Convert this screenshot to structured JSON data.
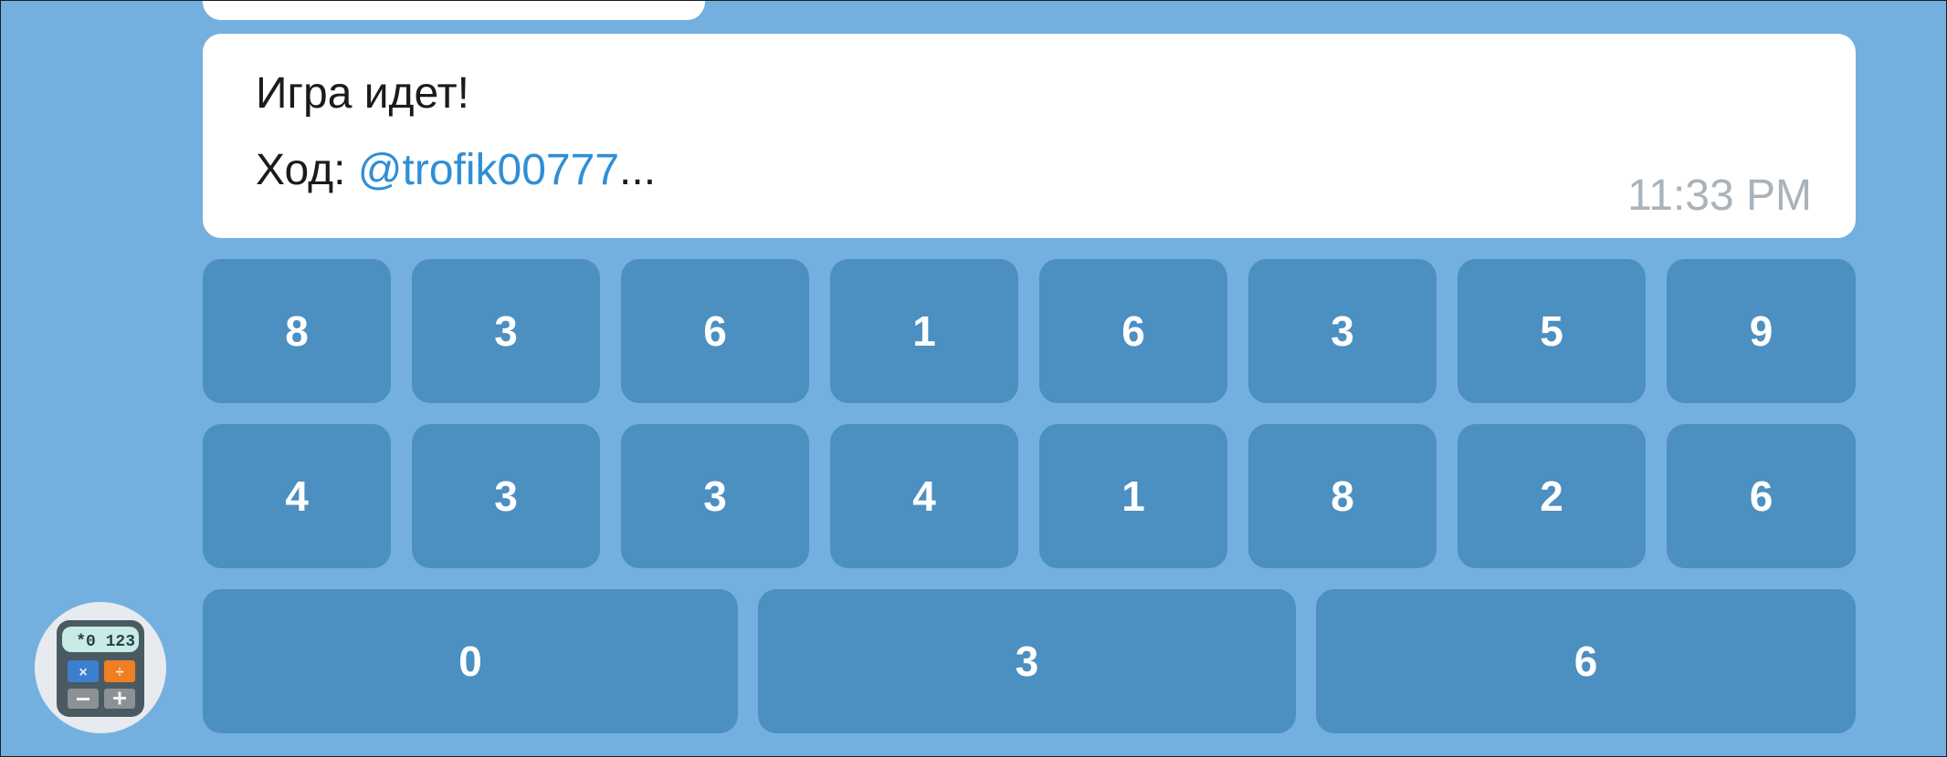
{
  "message": {
    "line1": "Игра идет!",
    "line2_prefix": "Ход: ",
    "mention": "@trofik00777",
    "ellipsis": "...",
    "time": "11:33 PM"
  },
  "keyboard": {
    "row1": [
      "8",
      "3",
      "6",
      "1",
      "6",
      "3",
      "5",
      "9"
    ],
    "row2": [
      "4",
      "3",
      "3",
      "4",
      "1",
      "8",
      "2",
      "6"
    ],
    "row3": [
      "0",
      "3",
      "6"
    ]
  },
  "avatar": {
    "icon": "calculator-icon",
    "display_text": "*0 123"
  },
  "colors": {
    "background": "#74b0df",
    "button": "#4c8fc1",
    "mention": "#2f8fd6",
    "time": "#a9b3bb",
    "bubble": "#ffffff"
  }
}
